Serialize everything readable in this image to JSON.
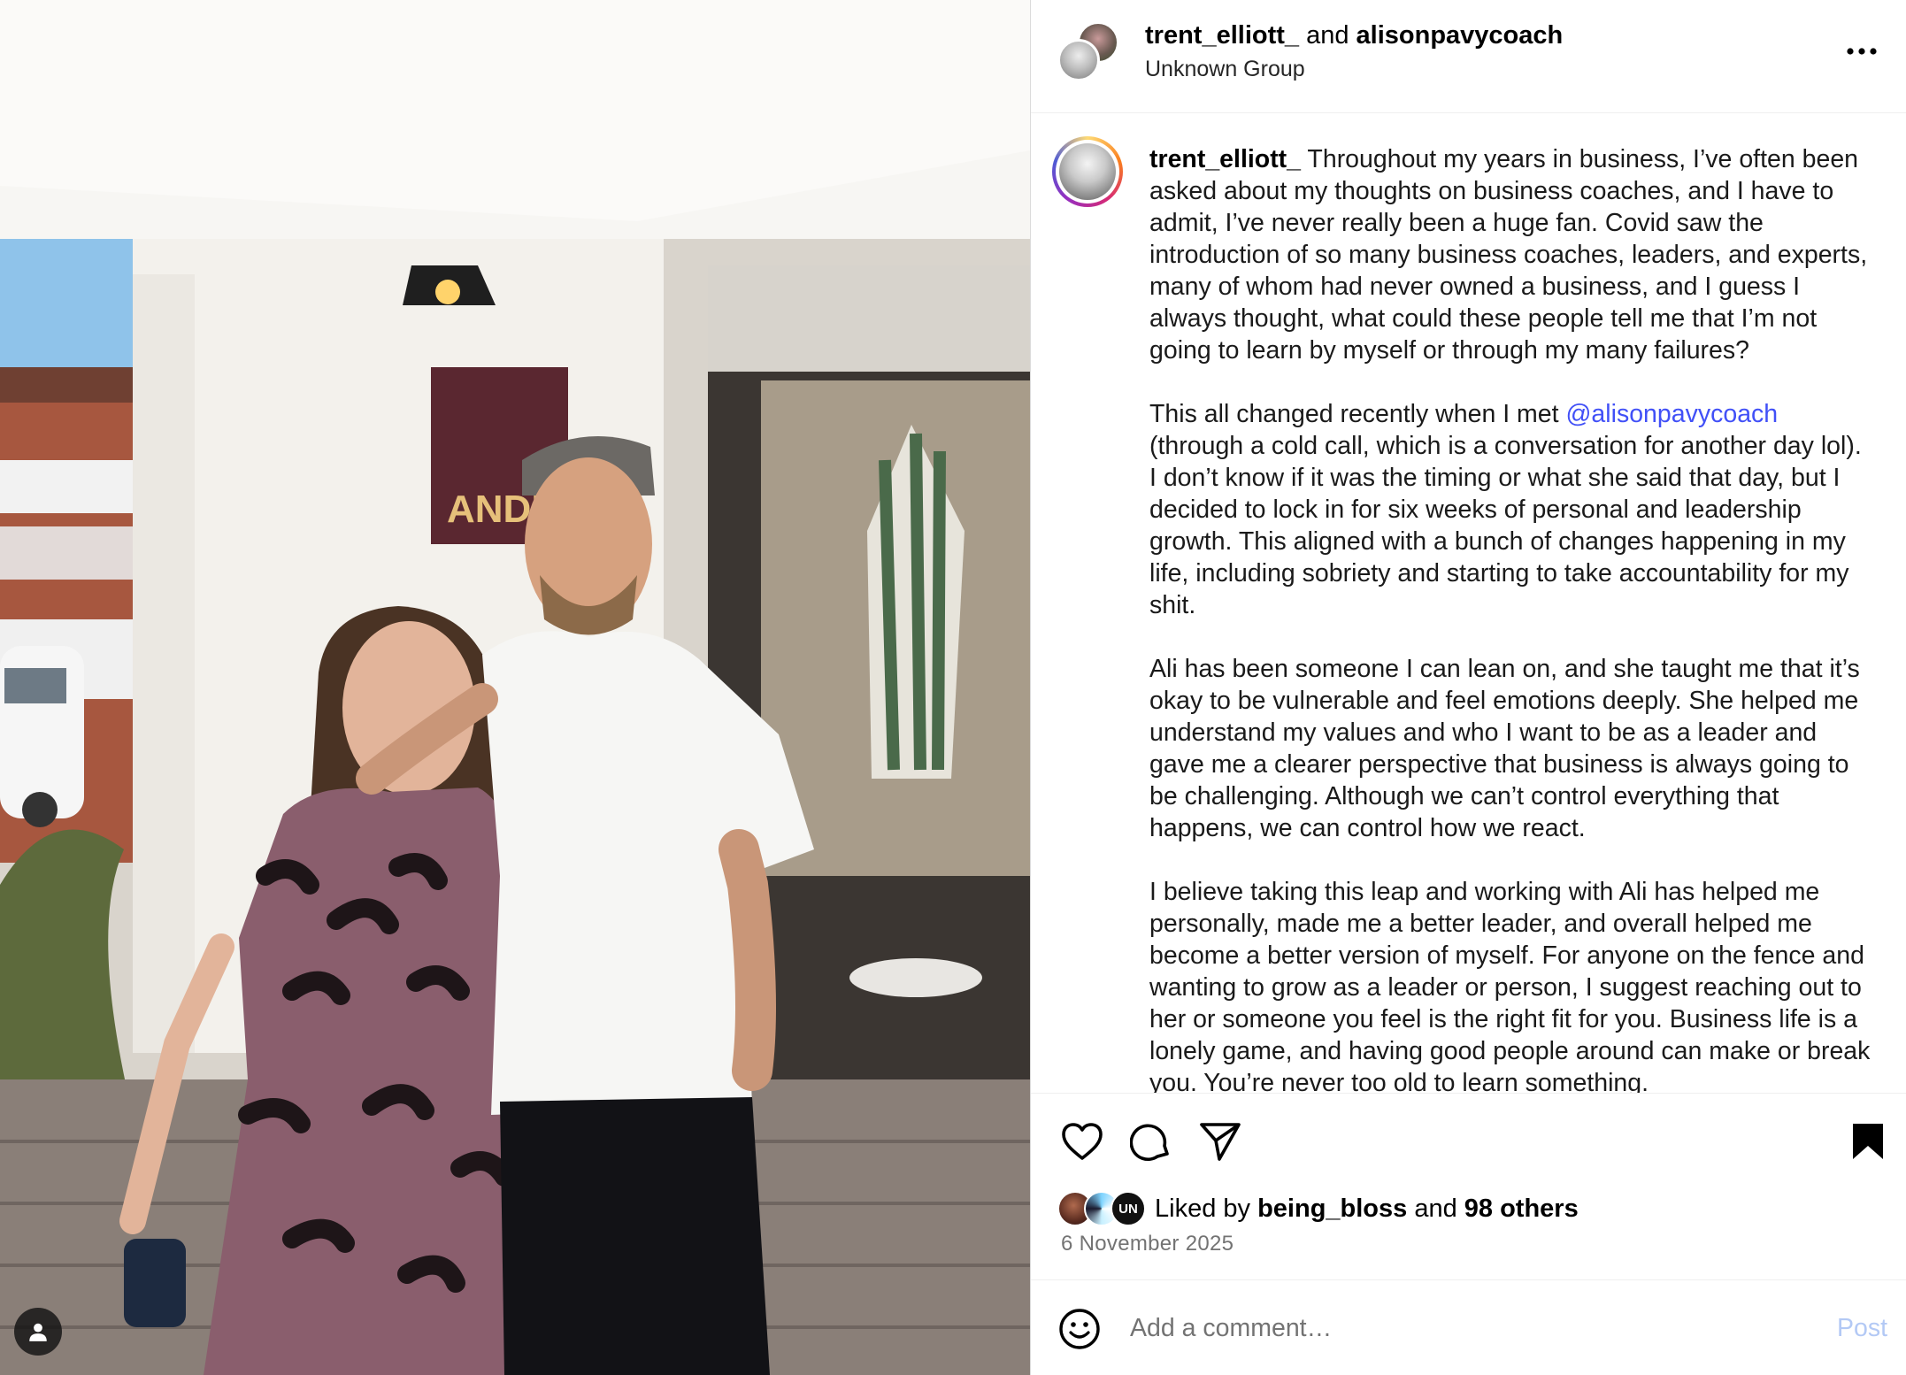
{
  "post": {
    "header": {
      "username_1": "trent_elliott_",
      "joiner": " and ",
      "username_2": "alisonpavycoach",
      "subtitle": "Unknown Group"
    },
    "photo": {
      "sign_text": "ANDIE"
    },
    "caption": {
      "username": "trent_elliott_",
      "p1": " Throughout my years in business, I’ve often been asked about my thoughts on business coaches, and I have to admit, I’ve never really been a huge fan. Covid saw the introduction of so many business coaches, leaders, and experts, many of whom had never owned a business, and I guess I always thought, what could these people tell me that I’m not going to learn by myself or through my many failures?",
      "p2_pre": "This all changed recently when I met ",
      "mention": "@alisonpavycoach",
      "p2_post": " (through a cold call, which is a conversation for another day lol). I don’t know if it was the timing or what she said that day, but I decided to lock in for six weeks of personal and leadership growth. This aligned with a bunch of changes happening in my life, including sobriety and starting to take accountability for my shit.",
      "p3": "Ali has been someone I can lean on, and she taught me that it’s okay to be vulnerable and feel emotions deeply. She helped me understand my values and who I want to be as a leader and gave me a clearer perspective that business is always going to be challenging. Although we can’t control everything that happens, we can control how we react.",
      "p4": "I believe taking this leap and working with Ali has helped me personally, made me a better leader, and overall helped me become a better version of myself. For anyone on the fence and wanting to grow as a leader or person, I suggest reaching out to her or someone you feel is the right fit for you. Business life is a lonely game, and having good people around can make or break you. You’re never too old to learn something."
    },
    "likes": {
      "prefix": "Liked by ",
      "user": "being_bloss",
      "joiner": " and ",
      "others": "98 others",
      "third_avatar_text": "UN"
    },
    "date": "6 November 2025",
    "comment": {
      "placeholder": "Add a comment…",
      "post_label": "Post"
    }
  },
  "icons": {
    "more": "more-horizontal-icon",
    "like": "heart-icon",
    "comment": "comment-bubble-icon",
    "share": "paper-plane-icon",
    "save": "bookmark-icon",
    "emoji": "smiley-icon",
    "tag": "user-tag-icon"
  },
  "colors": {
    "mention": "#4150f7",
    "post_button_disabled": "#b3c9f5",
    "muted_text": "#737373",
    "divider": "#efefef"
  }
}
